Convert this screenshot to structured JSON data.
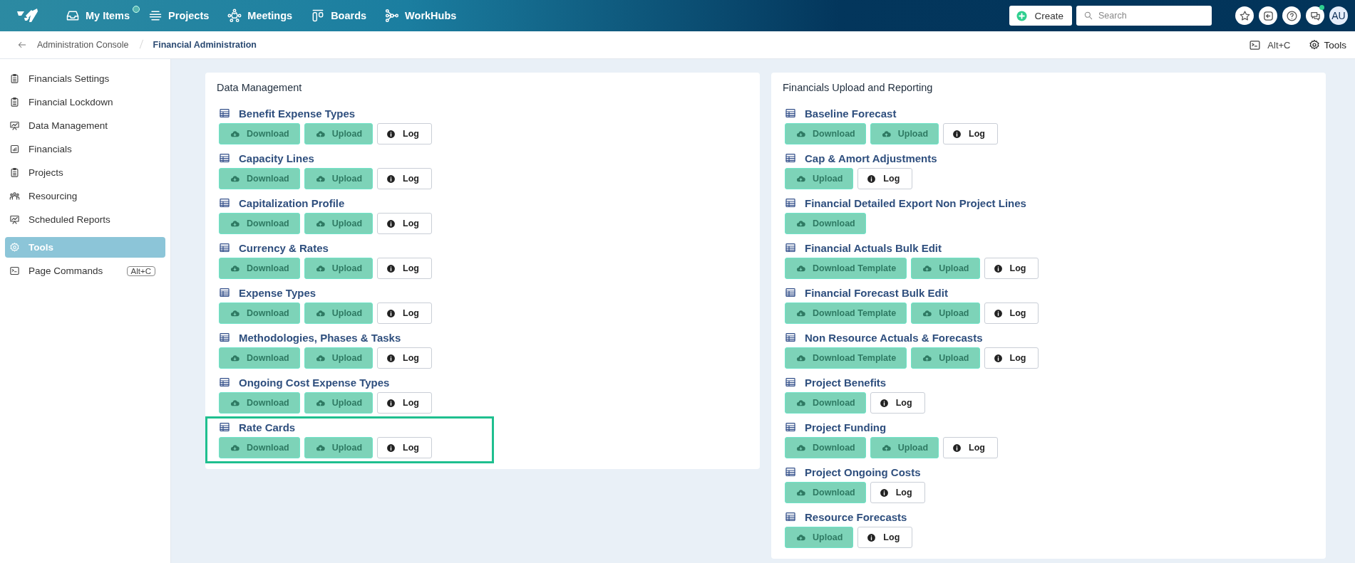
{
  "top_nav": {
    "items": [
      {
        "label": "My Items",
        "notification": true
      },
      {
        "label": "Projects",
        "notification": false
      },
      {
        "label": "Meetings",
        "notification": false
      },
      {
        "label": "Boards",
        "notification": false
      },
      {
        "label": "WorkHubs",
        "notification": false
      }
    ]
  },
  "create_button": "Create",
  "search": {
    "placeholder": "Search"
  },
  "toolbar_icons": [
    {
      "kind": "star",
      "notification": false
    },
    {
      "kind": "exit",
      "notification": false
    },
    {
      "kind": "help",
      "notification": false
    },
    {
      "kind": "chat",
      "notification": true
    }
  ],
  "avatar": "AU",
  "breadcrumb": {
    "items": [
      "Administration Console",
      "Financial Administration"
    ]
  },
  "page_commands": {
    "shortcut": "Alt+C"
  },
  "tools_button": "Tools",
  "sidebar": {
    "items": [
      {
        "label": "Financials Settings",
        "selected": false
      },
      {
        "label": "Financial Lockdown",
        "selected": false
      },
      {
        "label": "Data Management",
        "selected": false
      },
      {
        "label": "Financials",
        "selected": false
      },
      {
        "label": "Projects",
        "selected": false
      },
      {
        "label": "Resourcing",
        "selected": false
      },
      {
        "label": "Scheduled Reports",
        "selected": false
      },
      {
        "label": "Tools",
        "selected": true
      },
      {
        "label": "Page Commands",
        "selected": false,
        "shortcut": "Alt+C"
      }
    ]
  },
  "cards": [
    {
      "title": "Data Management",
      "items": [
        {
          "label": "Benefit Expense Types",
          "highlighted": false,
          "buttons": [
            {
              "kind": "download",
              "label": "Download"
            },
            {
              "kind": "upload",
              "label": "Upload"
            },
            {
              "kind": "log",
              "label": "Log"
            }
          ]
        },
        {
          "label": "Capacity Lines",
          "highlighted": false,
          "buttons": [
            {
              "kind": "download",
              "label": "Download"
            },
            {
              "kind": "upload",
              "label": "Upload"
            },
            {
              "kind": "log",
              "label": "Log"
            }
          ]
        },
        {
          "label": "Capitalization Profile",
          "highlighted": false,
          "buttons": [
            {
              "kind": "download",
              "label": "Download"
            },
            {
              "kind": "upload",
              "label": "Upload"
            },
            {
              "kind": "log",
              "label": "Log"
            }
          ]
        },
        {
          "label": "Currency & Rates",
          "highlighted": false,
          "buttons": [
            {
              "kind": "download",
              "label": "Download"
            },
            {
              "kind": "upload",
              "label": "Upload"
            },
            {
              "kind": "log",
              "label": "Log"
            }
          ]
        },
        {
          "label": "Expense Types",
          "highlighted": false,
          "buttons": [
            {
              "kind": "download",
              "label": "Download"
            },
            {
              "kind": "upload",
              "label": "Upload"
            },
            {
              "kind": "log",
              "label": "Log"
            }
          ]
        },
        {
          "label": "Methodologies, Phases & Tasks",
          "highlighted": false,
          "buttons": [
            {
              "kind": "download",
              "label": "Download"
            },
            {
              "kind": "upload",
              "label": "Upload"
            },
            {
              "kind": "log",
              "label": "Log"
            }
          ]
        },
        {
          "label": "Ongoing Cost Expense Types",
          "highlighted": false,
          "buttons": [
            {
              "kind": "download",
              "label": "Download"
            },
            {
              "kind": "upload",
              "label": "Upload"
            },
            {
              "kind": "log",
              "label": "Log"
            }
          ]
        },
        {
          "label": "Rate Cards",
          "highlighted": true,
          "buttons": [
            {
              "kind": "download",
              "label": "Download"
            },
            {
              "kind": "upload",
              "label": "Upload"
            },
            {
              "kind": "log",
              "label": "Log"
            }
          ]
        }
      ]
    },
    {
      "title": "Financials Upload and Reporting",
      "items": [
        {
          "label": "Baseline Forecast",
          "highlighted": false,
          "buttons": [
            {
              "kind": "download",
              "label": "Download"
            },
            {
              "kind": "upload",
              "label": "Upload"
            },
            {
              "kind": "log",
              "label": "Log"
            }
          ]
        },
        {
          "label": "Cap & Amort Adjustments",
          "highlighted": false,
          "buttons": [
            {
              "kind": "upload",
              "label": "Upload"
            },
            {
              "kind": "log",
              "label": "Log"
            }
          ]
        },
        {
          "label": "Financial Detailed Export Non Project Lines",
          "highlighted": false,
          "buttons": [
            {
              "kind": "download",
              "label": "Download"
            }
          ]
        },
        {
          "label": "Financial Actuals Bulk Edit",
          "highlighted": false,
          "buttons": [
            {
              "kind": "download",
              "label": "Download Template"
            },
            {
              "kind": "upload",
              "label": "Upload"
            },
            {
              "kind": "log",
              "label": "Log"
            }
          ]
        },
        {
          "label": "Financial Forecast Bulk Edit",
          "highlighted": false,
          "buttons": [
            {
              "kind": "download",
              "label": "Download Template"
            },
            {
              "kind": "upload",
              "label": "Upload"
            },
            {
              "kind": "log",
              "label": "Log"
            }
          ]
        },
        {
          "label": "Non Resource Actuals & Forecasts",
          "highlighted": false,
          "buttons": [
            {
              "kind": "download",
              "label": "Download Template"
            },
            {
              "kind": "upload",
              "label": "Upload"
            },
            {
              "kind": "log",
              "label": "Log"
            }
          ]
        },
        {
          "label": "Project Benefits",
          "highlighted": false,
          "buttons": [
            {
              "kind": "download",
              "label": "Download"
            },
            {
              "kind": "log",
              "label": "Log"
            }
          ]
        },
        {
          "label": "Project Funding",
          "highlighted": false,
          "buttons": [
            {
              "kind": "download",
              "label": "Download"
            },
            {
              "kind": "upload",
              "label": "Upload"
            },
            {
              "kind": "log",
              "label": "Log"
            }
          ]
        },
        {
          "label": "Project Ongoing Costs",
          "highlighted": false,
          "buttons": [
            {
              "kind": "download",
              "label": "Download"
            },
            {
              "kind": "log",
              "label": "Log"
            }
          ]
        },
        {
          "label": "Resource Forecasts",
          "highlighted": false,
          "buttons": [
            {
              "kind": "upload",
              "label": "Upload"
            },
            {
              "kind": "log",
              "label": "Log"
            }
          ]
        }
      ]
    }
  ]
}
